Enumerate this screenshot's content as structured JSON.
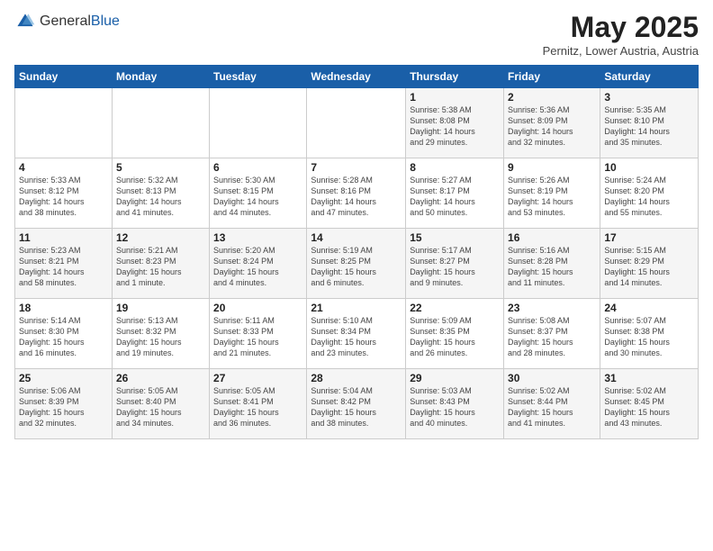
{
  "logo": {
    "general": "General",
    "blue": "Blue"
  },
  "title": "May 2025",
  "subtitle": "Pernitz, Lower Austria, Austria",
  "days_header": [
    "Sunday",
    "Monday",
    "Tuesday",
    "Wednesday",
    "Thursday",
    "Friday",
    "Saturday"
  ],
  "weeks": [
    [
      {
        "day": "",
        "info": ""
      },
      {
        "day": "",
        "info": ""
      },
      {
        "day": "",
        "info": ""
      },
      {
        "day": "",
        "info": ""
      },
      {
        "day": "1",
        "info": "Sunrise: 5:38 AM\nSunset: 8:08 PM\nDaylight: 14 hours\nand 29 minutes."
      },
      {
        "day": "2",
        "info": "Sunrise: 5:36 AM\nSunset: 8:09 PM\nDaylight: 14 hours\nand 32 minutes."
      },
      {
        "day": "3",
        "info": "Sunrise: 5:35 AM\nSunset: 8:10 PM\nDaylight: 14 hours\nand 35 minutes."
      }
    ],
    [
      {
        "day": "4",
        "info": "Sunrise: 5:33 AM\nSunset: 8:12 PM\nDaylight: 14 hours\nand 38 minutes."
      },
      {
        "day": "5",
        "info": "Sunrise: 5:32 AM\nSunset: 8:13 PM\nDaylight: 14 hours\nand 41 minutes."
      },
      {
        "day": "6",
        "info": "Sunrise: 5:30 AM\nSunset: 8:15 PM\nDaylight: 14 hours\nand 44 minutes."
      },
      {
        "day": "7",
        "info": "Sunrise: 5:28 AM\nSunset: 8:16 PM\nDaylight: 14 hours\nand 47 minutes."
      },
      {
        "day": "8",
        "info": "Sunrise: 5:27 AM\nSunset: 8:17 PM\nDaylight: 14 hours\nand 50 minutes."
      },
      {
        "day": "9",
        "info": "Sunrise: 5:26 AM\nSunset: 8:19 PM\nDaylight: 14 hours\nand 53 minutes."
      },
      {
        "day": "10",
        "info": "Sunrise: 5:24 AM\nSunset: 8:20 PM\nDaylight: 14 hours\nand 55 minutes."
      }
    ],
    [
      {
        "day": "11",
        "info": "Sunrise: 5:23 AM\nSunset: 8:21 PM\nDaylight: 14 hours\nand 58 minutes."
      },
      {
        "day": "12",
        "info": "Sunrise: 5:21 AM\nSunset: 8:23 PM\nDaylight: 15 hours\nand 1 minute."
      },
      {
        "day": "13",
        "info": "Sunrise: 5:20 AM\nSunset: 8:24 PM\nDaylight: 15 hours\nand 4 minutes."
      },
      {
        "day": "14",
        "info": "Sunrise: 5:19 AM\nSunset: 8:25 PM\nDaylight: 15 hours\nand 6 minutes."
      },
      {
        "day": "15",
        "info": "Sunrise: 5:17 AM\nSunset: 8:27 PM\nDaylight: 15 hours\nand 9 minutes."
      },
      {
        "day": "16",
        "info": "Sunrise: 5:16 AM\nSunset: 8:28 PM\nDaylight: 15 hours\nand 11 minutes."
      },
      {
        "day": "17",
        "info": "Sunrise: 5:15 AM\nSunset: 8:29 PM\nDaylight: 15 hours\nand 14 minutes."
      }
    ],
    [
      {
        "day": "18",
        "info": "Sunrise: 5:14 AM\nSunset: 8:30 PM\nDaylight: 15 hours\nand 16 minutes."
      },
      {
        "day": "19",
        "info": "Sunrise: 5:13 AM\nSunset: 8:32 PM\nDaylight: 15 hours\nand 19 minutes."
      },
      {
        "day": "20",
        "info": "Sunrise: 5:11 AM\nSunset: 8:33 PM\nDaylight: 15 hours\nand 21 minutes."
      },
      {
        "day": "21",
        "info": "Sunrise: 5:10 AM\nSunset: 8:34 PM\nDaylight: 15 hours\nand 23 minutes."
      },
      {
        "day": "22",
        "info": "Sunrise: 5:09 AM\nSunset: 8:35 PM\nDaylight: 15 hours\nand 26 minutes."
      },
      {
        "day": "23",
        "info": "Sunrise: 5:08 AM\nSunset: 8:37 PM\nDaylight: 15 hours\nand 28 minutes."
      },
      {
        "day": "24",
        "info": "Sunrise: 5:07 AM\nSunset: 8:38 PM\nDaylight: 15 hours\nand 30 minutes."
      }
    ],
    [
      {
        "day": "25",
        "info": "Sunrise: 5:06 AM\nSunset: 8:39 PM\nDaylight: 15 hours\nand 32 minutes."
      },
      {
        "day": "26",
        "info": "Sunrise: 5:05 AM\nSunset: 8:40 PM\nDaylight: 15 hours\nand 34 minutes."
      },
      {
        "day": "27",
        "info": "Sunrise: 5:05 AM\nSunset: 8:41 PM\nDaylight: 15 hours\nand 36 minutes."
      },
      {
        "day": "28",
        "info": "Sunrise: 5:04 AM\nSunset: 8:42 PM\nDaylight: 15 hours\nand 38 minutes."
      },
      {
        "day": "29",
        "info": "Sunrise: 5:03 AM\nSunset: 8:43 PM\nDaylight: 15 hours\nand 40 minutes."
      },
      {
        "day": "30",
        "info": "Sunrise: 5:02 AM\nSunset: 8:44 PM\nDaylight: 15 hours\nand 41 minutes."
      },
      {
        "day": "31",
        "info": "Sunrise: 5:02 AM\nSunset: 8:45 PM\nDaylight: 15 hours\nand 43 minutes."
      }
    ]
  ]
}
